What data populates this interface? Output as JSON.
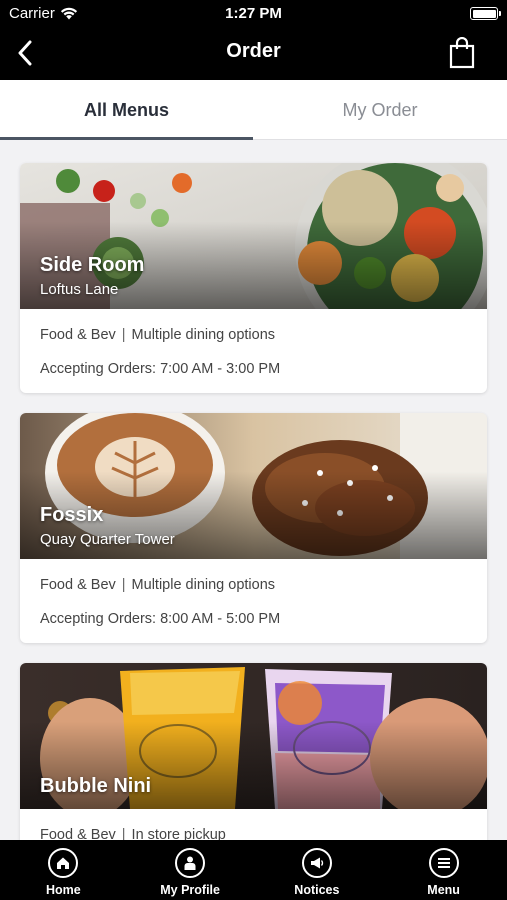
{
  "status_bar": {
    "carrier": "Carrier",
    "time": "1:27 PM"
  },
  "nav": {
    "title": "Order"
  },
  "tabs": [
    {
      "label": "All Menus",
      "active": true
    },
    {
      "label": "My Order",
      "active": false
    }
  ],
  "venues": [
    {
      "name": "Side Room",
      "location": "Loftus Lane",
      "category": "Food & Bev",
      "option": "Multiple dining options",
      "hours": "Accepting Orders: 7:00 AM - 3:00 PM"
    },
    {
      "name": "Fossix",
      "location": "Quay Quarter Tower",
      "category": "Food & Bev",
      "option": "Multiple dining options",
      "hours": "Accepting Orders: 8:00 AM - 5:00 PM"
    },
    {
      "name": "Bubble Nini",
      "location": "",
      "category": "Food & Bev",
      "option": "In store pickup",
      "hours": ""
    }
  ],
  "tabbar": [
    {
      "label": "Home",
      "icon": "home-icon"
    },
    {
      "label": "My Profile",
      "icon": "profile-icon"
    },
    {
      "label": "Notices",
      "icon": "megaphone-icon"
    },
    {
      "label": "Menu",
      "icon": "menu-icon"
    }
  ],
  "colors": {
    "bar": "#000000",
    "background": "#f2f2f4",
    "tab_indicator": "#4b5563"
  }
}
